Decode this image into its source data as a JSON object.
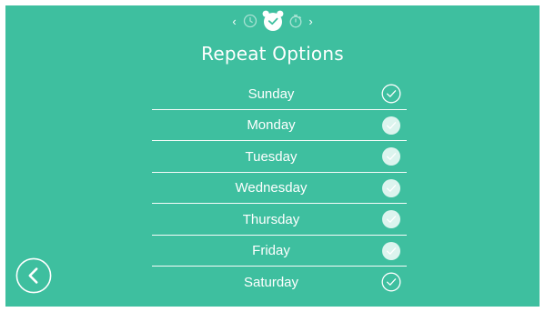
{
  "screen": {
    "background_color": "#3ebf9f",
    "foreground_color": "#ffffff"
  },
  "mode_switcher": {
    "prev_icon": "chevron-left-icon",
    "next_icon": "chevron-right-icon",
    "prev_glyph": "‹",
    "next_glyph": "›",
    "modes": [
      {
        "icon": "clock-icon",
        "active": false
      },
      {
        "icon": "alarm-clock-icon",
        "active": true
      },
      {
        "icon": "stopwatch-icon",
        "active": false
      }
    ]
  },
  "title": "Repeat Options",
  "days": [
    {
      "label": "Sunday",
      "checked": true,
      "check_style": "outline"
    },
    {
      "label": "Monday",
      "checked": true,
      "check_style": "filled"
    },
    {
      "label": "Tuesday",
      "checked": true,
      "check_style": "filled"
    },
    {
      "label": "Wednesday",
      "checked": true,
      "check_style": "filled"
    },
    {
      "label": "Thursday",
      "checked": true,
      "check_style": "filled"
    },
    {
      "label": "Friday",
      "checked": true,
      "check_style": "filled"
    },
    {
      "label": "Saturday",
      "checked": true,
      "check_style": "outline"
    }
  ],
  "back_button": {
    "icon": "chevron-left-icon"
  }
}
